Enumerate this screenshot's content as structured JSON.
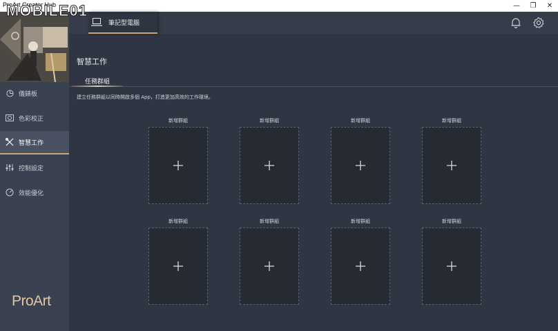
{
  "window": {
    "title": "ProArt Creator Hub",
    "controls": {
      "minimize": "—",
      "restore": "❐",
      "close": "✕"
    }
  },
  "watermark": "MOBILE01",
  "header": {
    "device_tab_label": "筆記型電腦",
    "icons": [
      "bell-icon",
      "gear-icon"
    ]
  },
  "sidebar": {
    "items": [
      {
        "label": "儀錶板",
        "icon": "dashboard-icon",
        "active": false
      },
      {
        "label": "色彩校正",
        "icon": "color-calibration-icon",
        "active": false
      },
      {
        "label": "智慧工作",
        "icon": "tools-icon",
        "active": true
      },
      {
        "label": "控制設定",
        "icon": "sliders-icon",
        "active": false
      },
      {
        "label": "效能優化",
        "icon": "performance-icon",
        "active": false
      }
    ],
    "brand": "ProArt"
  },
  "main": {
    "title": "智慧工作",
    "subtab": "任務群組",
    "description": "建立任務群組以同時開啟多個 App，打造更加高效的工作環境。",
    "groups": [
      {
        "label": "新增群組"
      },
      {
        "label": "新增群組"
      },
      {
        "label": "新增群組"
      },
      {
        "label": "新增群組"
      },
      {
        "label": "新增群組"
      },
      {
        "label": "新增群組"
      },
      {
        "label": "新增群組"
      },
      {
        "label": "新增群組"
      }
    ]
  },
  "colors": {
    "accent": "#c9a77a",
    "background": "#2f3542",
    "sidebar": "#3a4150",
    "card": "#262a33"
  }
}
